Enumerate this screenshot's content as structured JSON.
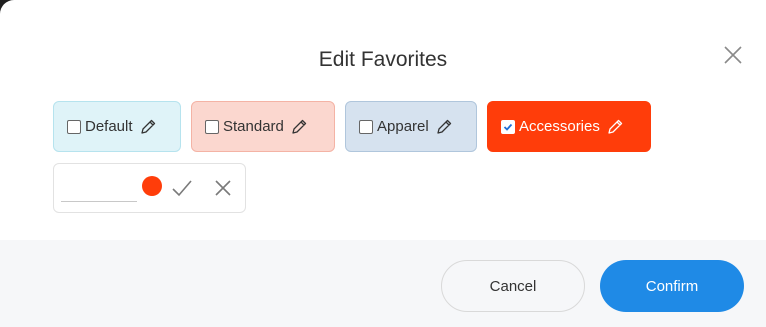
{
  "dialog": {
    "title": "Edit Favorites",
    "close_icon": "close-icon"
  },
  "tags": [
    {
      "label": "Default",
      "checked": false,
      "color": "#dff3f8",
      "icon": "pencil-icon"
    },
    {
      "label": "Standard",
      "checked": false,
      "color": "#fbd7cf",
      "icon": "pencil-icon"
    },
    {
      "label": "Apparel",
      "checked": false,
      "color": "#d6e2ef",
      "icon": "pencil-icon"
    },
    {
      "label": "Accessories",
      "checked": true,
      "color": "#ff3d0a",
      "icon": "pencil-icon"
    }
  ],
  "editor": {
    "name_value": "",
    "selected_color": "#ff3d0a",
    "confirm_icon": "check-icon",
    "cancel_icon": "close-icon"
  },
  "footer": {
    "cancel_label": "Cancel",
    "confirm_label": "Confirm",
    "confirm_color": "#1f8ae6"
  }
}
